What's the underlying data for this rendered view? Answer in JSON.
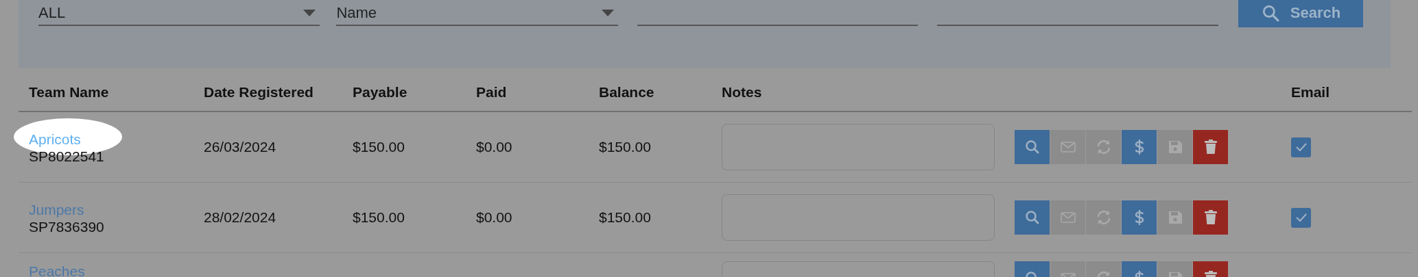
{
  "filters": {
    "selects": [
      {
        "value": "ALL"
      },
      {
        "value": "Name"
      }
    ],
    "text_fields": [
      {
        "kind": "text"
      },
      {
        "kind": "text"
      }
    ],
    "search_button": {
      "label": "Search"
    }
  },
  "table": {
    "columns": [
      "Team Name",
      "Date Registered",
      "Payable",
      "Paid",
      "Balance",
      "Notes",
      "Email"
    ],
    "rows": [
      {
        "name": "Apricots",
        "code": "SP8022541",
        "date": "26/03/2024",
        "payable": "$150.00",
        "paid": "$0.00",
        "balance": "$150.00",
        "highlighted": true,
        "email_checked": true,
        "actions": [
          {
            "kind": "view",
            "disabled": false
          },
          {
            "kind": "email",
            "disabled": true
          },
          {
            "kind": "refresh",
            "disabled": true
          },
          {
            "kind": "payment",
            "disabled": false
          },
          {
            "kind": "save",
            "disabled": true
          },
          {
            "kind": "delete",
            "disabled": false
          }
        ]
      },
      {
        "name": "Jumpers",
        "code": "SP7836390",
        "date": "28/02/2024",
        "payable": "$150.00",
        "paid": "$0.00",
        "balance": "$150.00",
        "highlighted": false,
        "email_checked": true,
        "actions": [
          {
            "kind": "view",
            "disabled": false
          },
          {
            "kind": "email",
            "disabled": true
          },
          {
            "kind": "refresh",
            "disabled": true
          },
          {
            "kind": "payment",
            "disabled": false
          },
          {
            "kind": "save",
            "disabled": true
          },
          {
            "kind": "delete",
            "disabled": false
          }
        ]
      },
      {
        "name": "Peaches",
        "highlighted": false,
        "actions": [
          {
            "kind": "view",
            "disabled": false
          },
          {
            "kind": "email",
            "disabled": true
          },
          {
            "kind": "refresh",
            "disabled": true
          },
          {
            "kind": "payment",
            "disabled": false
          },
          {
            "kind": "save",
            "disabled": true
          },
          {
            "kind": "delete",
            "disabled": false
          }
        ]
      }
    ]
  }
}
